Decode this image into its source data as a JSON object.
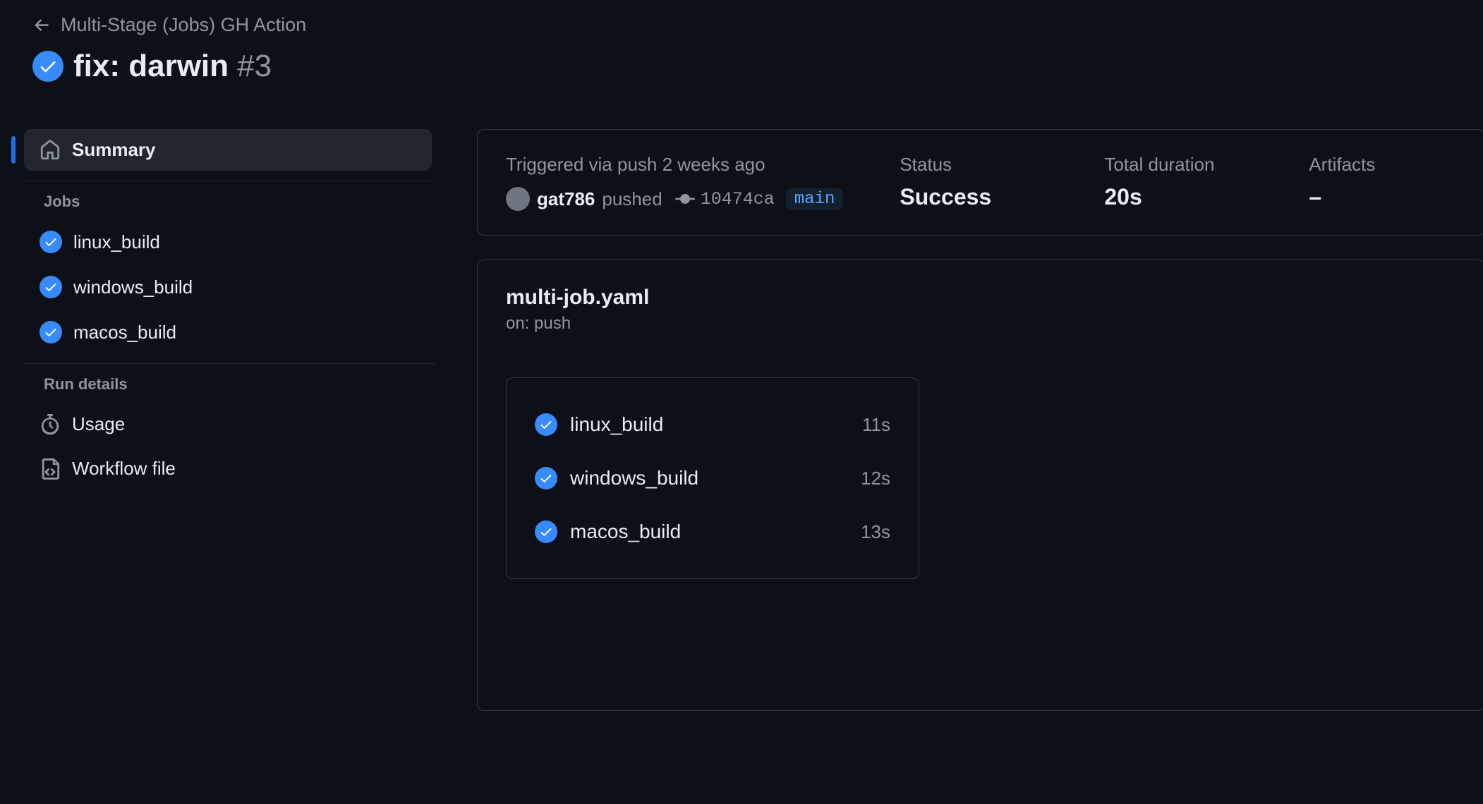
{
  "breadcrumb": {
    "workflow_name": "Multi-Stage (Jobs) GH Action"
  },
  "title": {
    "status": "success",
    "name": "fix: darwin",
    "run_number": "#3"
  },
  "sidebar": {
    "summary_label": "Summary",
    "jobs_heading": "Jobs",
    "jobs": [
      {
        "name": "linux_build",
        "status": "success"
      },
      {
        "name": "windows_build",
        "status": "success"
      },
      {
        "name": "macos_build",
        "status": "success"
      }
    ],
    "run_details_heading": "Run details",
    "usage_label": "Usage",
    "workflow_file_label": "Workflow file"
  },
  "meta": {
    "triggered_text": "Triggered via push 2 weeks ago",
    "author": "gat786",
    "pushed_word": "pushed",
    "commit_sha": "10474ca",
    "branch": "main",
    "status_label": "Status",
    "status_value": "Success",
    "duration_label": "Total duration",
    "duration_value": "20s",
    "artifacts_label": "Artifacts",
    "artifacts_value": "–"
  },
  "workflow": {
    "file": "multi-job.yaml",
    "on_label": "on: push",
    "jobs": [
      {
        "name": "linux_build",
        "duration": "11s",
        "status": "success"
      },
      {
        "name": "windows_build",
        "duration": "12s",
        "status": "success"
      },
      {
        "name": "macos_build",
        "duration": "13s",
        "status": "success"
      }
    ]
  }
}
